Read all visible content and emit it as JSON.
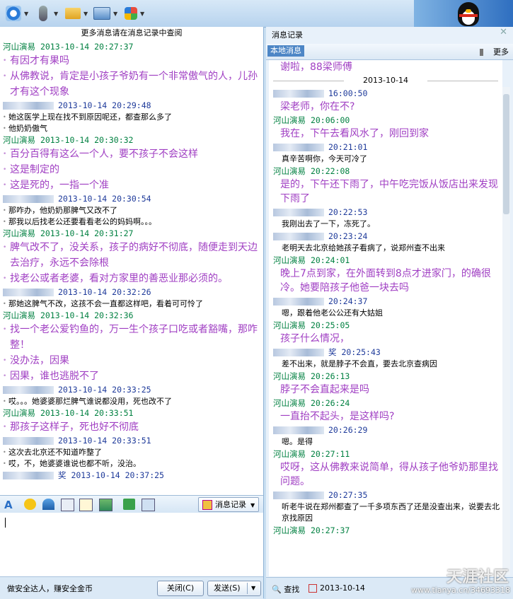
{
  "toolbar": {
    "colors": {
      "bg": "#c7ddf2"
    },
    "buttons": [
      {
        "icon": "qq-status-icon"
      },
      {
        "icon": "microphone-icon"
      },
      {
        "icon": "folder-icon"
      },
      {
        "icon": "remote-desktop-icon"
      },
      {
        "icon": "apps-icon"
      }
    ]
  },
  "left": {
    "top_notice": "更多消息请在消息记录中查阅",
    "messages": [
      {
        "who": "me",
        "name": "河山演易",
        "time": "2013-10-14 20:27:37",
        "lines": [
          "有因才有果吗",
          "从佛教说，肯定是小孩子爷奶有一个非常傲气的人，儿孙才有这个现象"
        ]
      },
      {
        "who": "other",
        "name": "",
        "time": "2013-10-14 20:29:48",
        "lines": [
          "她这医学上现在找不到原因呢还，都查那么多了",
          "他奶奶傲气"
        ]
      },
      {
        "who": "me",
        "name": "河山演易",
        "time": "2013-10-14 20:30:32",
        "lines": [
          "百分百得有这么一个人，要不孩子不会这样",
          "这是制定的",
          "这是死的，一指一个准"
        ]
      },
      {
        "who": "other",
        "name": "",
        "time": "2013-10-14 20:30:54",
        "lines": [
          "那咋办，他奶奶那脾气又改不了",
          "那我以后找老公还要看看老公的妈妈啊。。。"
        ]
      },
      {
        "who": "me",
        "name": "河山演易",
        "time": "2013-10-14 20:31:27",
        "lines": [
          "脾气改不了，没关系，孩子的病好不彻底，随便走到天边去治疗，永远不会除根",
          "找老公或者老婆，看对方家里的善恶业那必须的。"
        ]
      },
      {
        "who": "other",
        "name": "",
        "time": "2013-10-14 20:32:26",
        "lines": [
          "那她这脾气不改，这孩不会一直都这样吧，看着可可怜了"
        ]
      },
      {
        "who": "me",
        "name": "河山演易",
        "time": "2013-10-14 20:32:36",
        "lines": [
          "找一个老公爱钓鱼的，万一生个孩子口吃或者豁嘴，那咋整！",
          "没办法，因果",
          "因果，谁也逃脱不了"
        ]
      },
      {
        "who": "other",
        "name": "",
        "time": "2013-10-14 20:33:25",
        "lines": [
          "哎。。。她婆婆那烂脾气谁说都没用，死也改不了"
        ]
      },
      {
        "who": "me",
        "name": "河山演易",
        "time": "2013-10-14 20:33:51",
        "lines": [
          "那孩子这样子，死也好不彻底"
        ]
      },
      {
        "who": "other",
        "name": "",
        "time": "2013-10-14 20:33:51",
        "lines": [
          "这次去北京还不知道咋整了",
          "哎，不，她婆婆谁说也都不听，没治。"
        ]
      },
      {
        "who": "other",
        "name": "奖",
        "time": "2013-10-14 20:37:25",
        "lines": []
      }
    ]
  },
  "format_bar": {
    "history_label": "消息记录"
  },
  "bottom": {
    "ad": "做安全达人，赚安全金币",
    "close_label": "关闭(C)",
    "send_label": "发送(S)"
  },
  "right": {
    "title": "消息记录",
    "tab": "本地消息",
    "more": "更多",
    "top_line": "谢啦，88梁师傅",
    "date_divider": "2013-10-14",
    "messages": [
      {
        "who": "other",
        "name": "",
        "time": "16:00:50",
        "lines": []
      },
      {
        "who": "me-text",
        "lines": [
          "梁老师，你在不?"
        ]
      },
      {
        "who": "me",
        "name": "河山演易",
        "time": "20:06:00",
        "lines": [
          "我在，下午去看风水了，刚回到家"
        ]
      },
      {
        "who": "other",
        "name": "",
        "time": "20:21:01",
        "lines": [
          "真辛苦啊你，今天可冷了"
        ]
      },
      {
        "who": "me",
        "name": "河山演易",
        "time": "20:22:08",
        "lines": [
          "是的，下午还下雨了，中午吃完饭从饭店出来发现下雨了"
        ]
      },
      {
        "who": "other",
        "name": "",
        "time": "20:22:53",
        "lines": [
          "我刚出去了一下，冻死了。"
        ]
      },
      {
        "who": "other",
        "name": "",
        "time": "20:23:24",
        "lines": [
          "老明天去北京给她孩子看病了，说郑州查不出来"
        ]
      },
      {
        "who": "me",
        "name": "河山演易",
        "time": "20:24:01",
        "lines": [
          "晚上7点到家，在外面转到8点才进家门，的确很冷。她要陪孩子他爸一块去吗"
        ]
      },
      {
        "who": "other",
        "name": "",
        "time": "20:24:37",
        "lines": [
          "嗯，跟着他老公公还有大姑姐"
        ]
      },
      {
        "who": "me",
        "name": "河山演易",
        "time": "20:25:05",
        "lines": [
          "孩子什么情况，"
        ]
      },
      {
        "who": "other",
        "name": "奖",
        "time": "20:25:43",
        "lines": [
          "差不出来，就是脖子不会直，要去北京查病因"
        ]
      },
      {
        "who": "me",
        "name": "河山演易",
        "time": "20:26:13",
        "lines": [
          "脖子不会直起来是吗"
        ]
      },
      {
        "who": "me",
        "name": "河山演易",
        "time": "20:26:24",
        "lines": [
          "一直抬不起头，是这样吗?"
        ]
      },
      {
        "who": "other",
        "name": "",
        "time": "20:26:29",
        "lines": [
          "嗯。是得"
        ]
      },
      {
        "who": "me",
        "name": "河山演易",
        "time": "20:27:11",
        "lines": [
          "哎呀，这从佛教来说简单，得从孩子他爷奶那里找问题。"
        ]
      },
      {
        "who": "other",
        "name": "",
        "time": "20:27:35",
        "lines": [
          "听老牛说在郑州都查了一千多项东西了还是没查出来，说要去北京找原因"
        ]
      },
      {
        "who": "me",
        "name": "河山演易",
        "time": "20:27:37",
        "lines": []
      }
    ],
    "find_label": "查找",
    "date_value": "2013-10-14"
  },
  "watermark": {
    "text": "天涯社区",
    "url": "www.tianya.cn/34693318"
  }
}
